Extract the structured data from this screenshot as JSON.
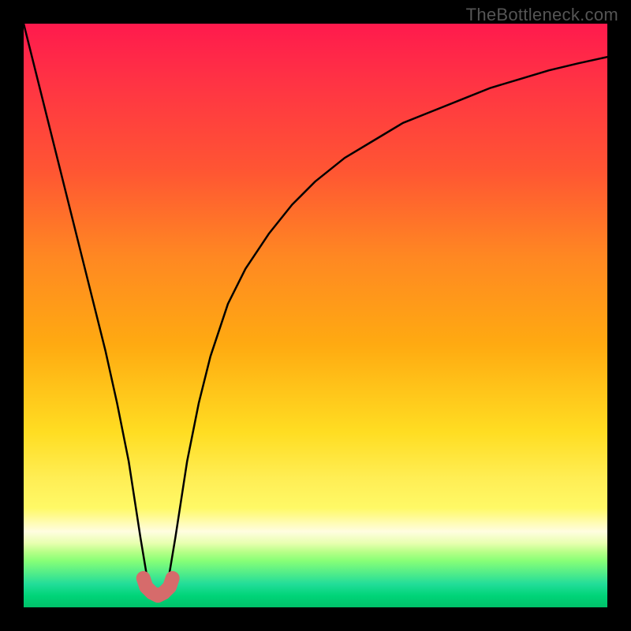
{
  "watermark": "TheBottleneck.com",
  "chart_data": {
    "type": "line",
    "title": "",
    "xlabel": "",
    "ylabel": "",
    "xlim": [
      0,
      100
    ],
    "ylim": [
      0,
      100
    ],
    "series": [
      {
        "name": "bottleneck-curve",
        "x": [
          0,
          2,
          4,
          6,
          8,
          10,
          12,
          14,
          16,
          18,
          20,
          21,
          22,
          23,
          24,
          25,
          26,
          28,
          30,
          32,
          35,
          38,
          42,
          46,
          50,
          55,
          60,
          65,
          70,
          75,
          80,
          85,
          90,
          95,
          100
        ],
        "values": [
          100,
          92,
          84,
          76,
          68,
          60,
          52,
          44,
          35,
          25,
          12,
          6,
          3,
          2,
          3,
          6,
          12,
          25,
          35,
          43,
          52,
          58,
          64,
          69,
          73,
          77,
          80,
          83,
          85,
          87,
          89,
          90.5,
          92,
          93.2,
          94.3
        ]
      }
    ],
    "highlight": {
      "name": "minimum-marker",
      "x": [
        20.5,
        21,
        22,
        23,
        24,
        25,
        25.5
      ],
      "values": [
        5,
        3.5,
        2.5,
        2,
        2.5,
        3.5,
        5
      ],
      "color": "#d66b6b"
    },
    "gradient_stops": [
      {
        "pos": 0,
        "color": "#ff1a4d"
      },
      {
        "pos": 25,
        "color": "#ff5533"
      },
      {
        "pos": 55,
        "color": "#ffaa11"
      },
      {
        "pos": 78,
        "color": "#ffee55"
      },
      {
        "pos": 90,
        "color": "#b8ff88"
      },
      {
        "pos": 100,
        "color": "#00c26a"
      }
    ]
  }
}
